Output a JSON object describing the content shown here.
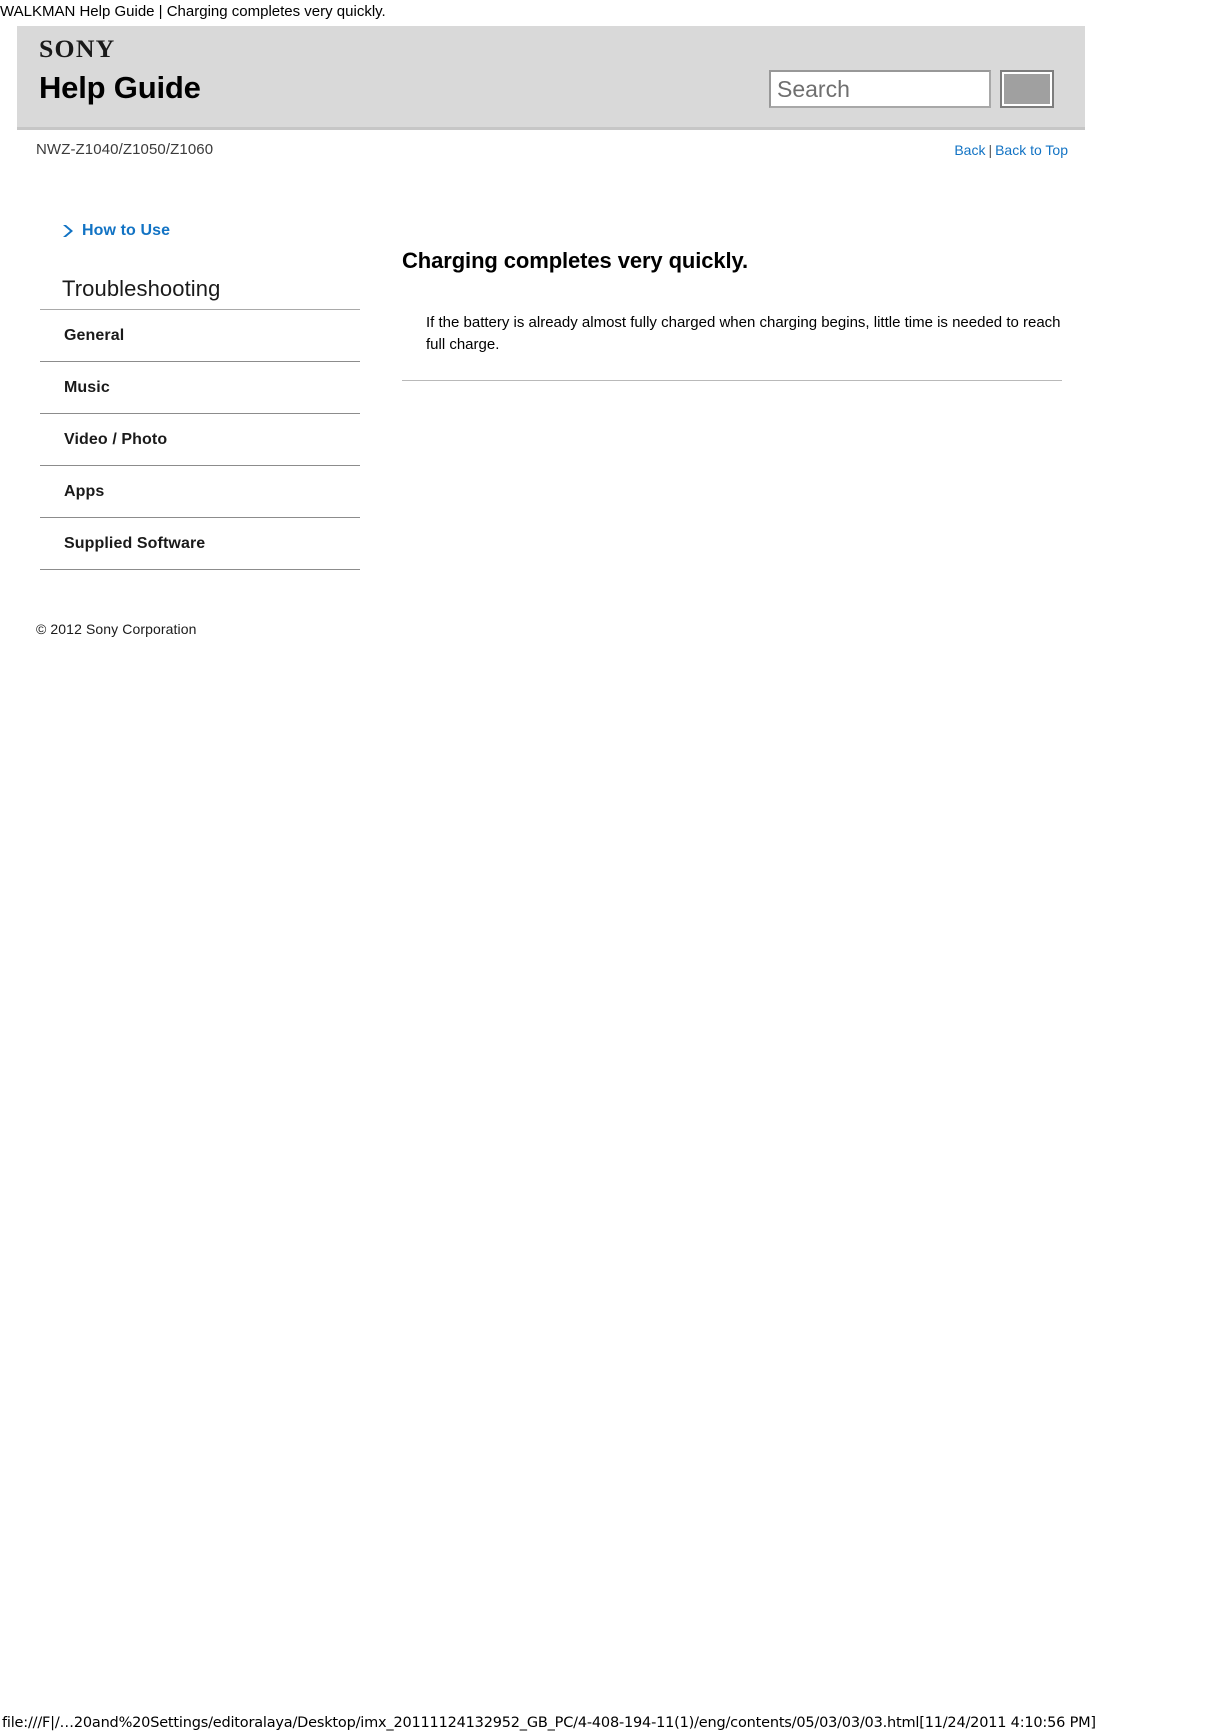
{
  "print_header": "WALKMAN Help Guide | Charging completes very quickly.",
  "header": {
    "logo": "SONY",
    "title": "Help Guide",
    "search": {
      "placeholder": "Search",
      "value": "",
      "button_icon": "search-icon"
    }
  },
  "subheader": {
    "model": "NWZ-Z1040/Z1050/Z1060",
    "back_label": "Back",
    "separator": "|",
    "back_to_top_label": "Back to Top"
  },
  "sidebar": {
    "how_to_use": {
      "icon": "chevron-right-icon",
      "label": "How to Use"
    },
    "section_title": "Troubleshooting",
    "items": [
      {
        "label": "General"
      },
      {
        "label": "Music"
      },
      {
        "label": "Video / Photo"
      },
      {
        "label": "Apps"
      },
      {
        "label": "Supplied Software"
      }
    ]
  },
  "main": {
    "title": "Charging completes very quickly.",
    "body": "If the battery is already almost fully charged when charging begins, little time is needed to reach full charge."
  },
  "footer": {
    "copyright": "© 2012 Sony Corporation",
    "url": "file:///F|/…20and%20Settings/editoralaya/Desktop/imx_20111124132952_GB_PC/4-408-194-11(1)/eng/contents/05/03/03/03.html[11/24/2011 4:10:56 PM]"
  },
  "colors": {
    "header_band": "#d9d9d9",
    "link_blue": "#1273c4",
    "rule_gray": "#8c8c8c"
  }
}
